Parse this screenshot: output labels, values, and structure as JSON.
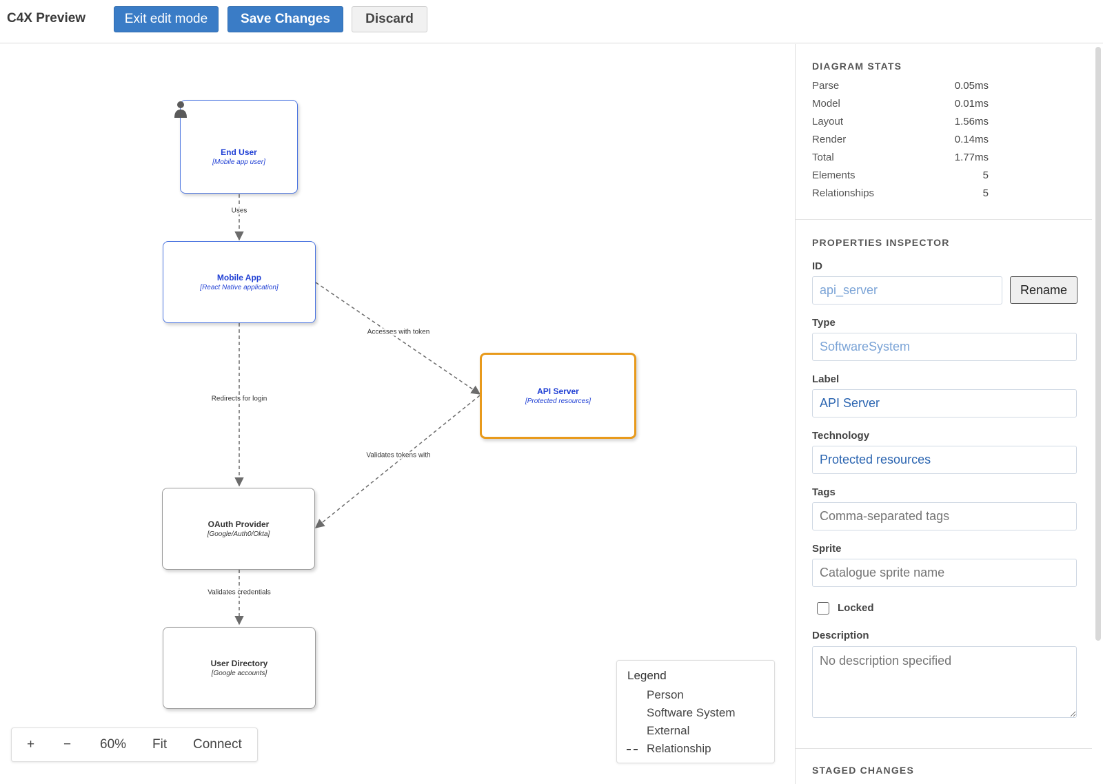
{
  "app": {
    "title": "C4X Preview"
  },
  "toolbar": {
    "exit_label": "Exit edit mode",
    "save_label": "Save Changes",
    "discard_label": "Discard"
  },
  "diagram": {
    "nodes": [
      {
        "id": "end_user",
        "label": "End User",
        "tech": "[Mobile app user]",
        "kind": "person"
      },
      {
        "id": "mobile_app",
        "label": "Mobile App",
        "tech": "[React Native application]",
        "kind": "internal"
      },
      {
        "id": "api_server",
        "label": "API Server",
        "tech": "[Protected resources]",
        "kind": "selected"
      },
      {
        "id": "oauth",
        "label": "OAuth Provider",
        "tech": "[Google/Auth0/Okta]",
        "kind": "external"
      },
      {
        "id": "user_dir",
        "label": "User Directory",
        "tech": "[Google accounts]",
        "kind": "external"
      }
    ],
    "edges": [
      {
        "label": "Uses"
      },
      {
        "label": "Accesses with token"
      },
      {
        "label": "Redirects for login"
      },
      {
        "label": "Validates tokens with"
      },
      {
        "label": "Validates credentials"
      }
    ],
    "colors": {
      "internal": "#4a74e0",
      "external": "#9a9a9a",
      "selected": "#e89a1c",
      "edge": "#6b6b6b"
    }
  },
  "zoom": {
    "plus": "+",
    "minus": "−",
    "level": "60%",
    "fit": "Fit",
    "connect": "Connect"
  },
  "legend": {
    "title": "Legend",
    "items": [
      "Person",
      "Software System",
      "External",
      "Relationship"
    ]
  },
  "stats": {
    "title": "DIAGRAM STATS",
    "rows": [
      {
        "name": "Parse",
        "value": "0.05ms"
      },
      {
        "name": "Model",
        "value": "0.01ms"
      },
      {
        "name": "Layout",
        "value": "1.56ms"
      },
      {
        "name": "Render",
        "value": "0.14ms"
      },
      {
        "name": "Total",
        "value": "1.77ms"
      },
      {
        "name": "Elements",
        "value": "5"
      },
      {
        "name": "Relationships",
        "value": "5"
      }
    ]
  },
  "inspector": {
    "title": "PROPERTIES INSPECTOR",
    "id_label": "ID",
    "id_value": "api_server",
    "rename_label": "Rename",
    "type_label": "Type",
    "type_value": "SoftwareSystem",
    "label_label": "Label",
    "label_value": "API Server",
    "technology_label": "Technology",
    "technology_value": "Protected resources",
    "tags_label": "Tags",
    "tags_placeholder": "Comma-separated tags",
    "sprite_label": "Sprite",
    "sprite_placeholder": "Catalogue sprite name",
    "locked_label": "Locked",
    "description_label": "Description",
    "description_placeholder": "No description specified"
  },
  "staged": {
    "title": "STAGED CHANGES"
  }
}
